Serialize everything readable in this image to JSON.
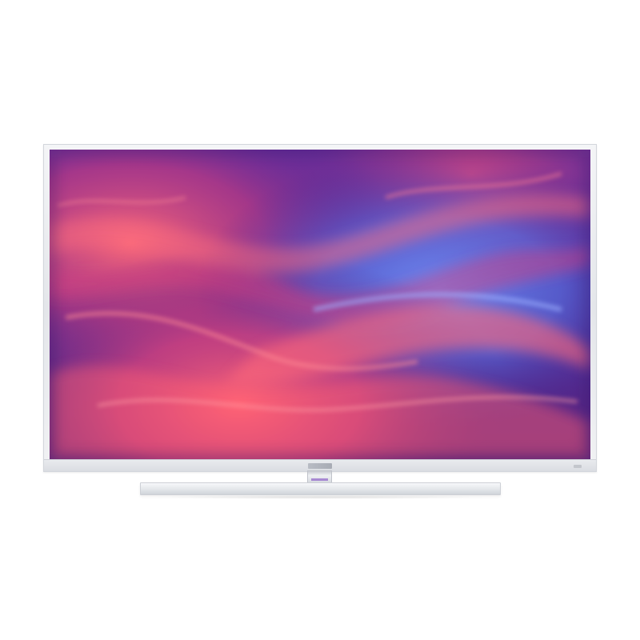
{
  "image": {
    "subject": "flat-screen-television",
    "background_color": "#ffffff",
    "frame_color": "#e8eaed",
    "stand_color": "#e6e8ec",
    "screen_palette": {
      "deep_purple": "#3b1f7a",
      "violet": "#6a2fa6",
      "magenta": "#c23a8c",
      "coral": "#ff5a6e",
      "blue": "#5a7cf0"
    }
  }
}
